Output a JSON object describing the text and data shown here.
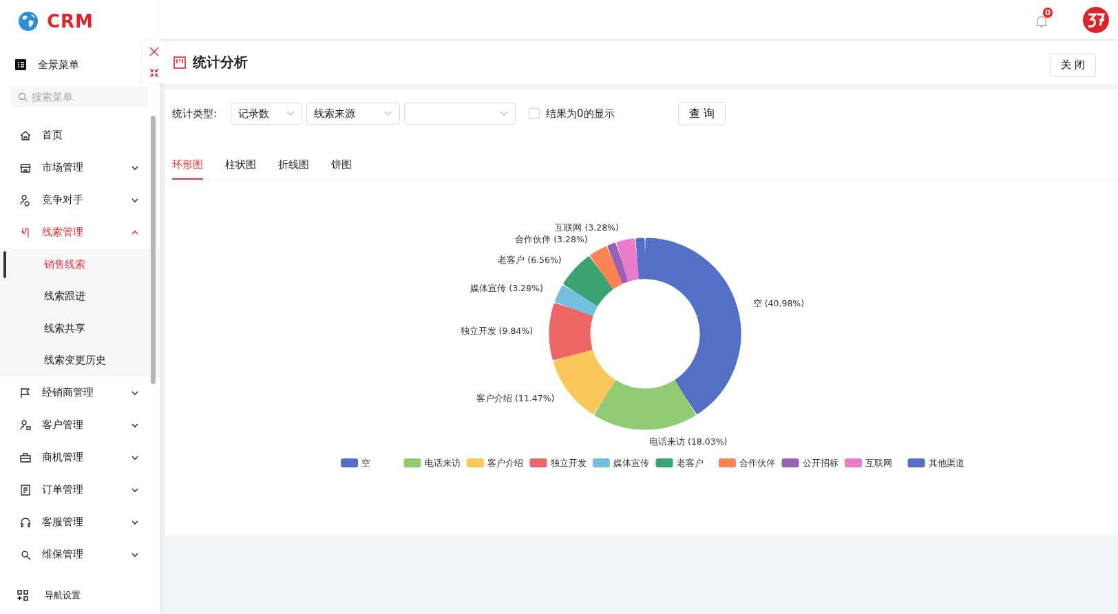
{
  "brand": {
    "logo_text": "CRM"
  },
  "topbar": {
    "notification_count": "0"
  },
  "sidebar": {
    "panorama_menu": "全景菜单",
    "search": {
      "placeholder": "搜索菜单"
    },
    "items": [
      {
        "label": "首页",
        "kind": "link",
        "selected": false
      },
      {
        "label": "市场管理",
        "kind": "group",
        "expanded": false,
        "selected": false
      },
      {
        "label": "竞争对手",
        "kind": "group",
        "expanded": false,
        "selected": false
      },
      {
        "label": "线索管理",
        "kind": "group",
        "expanded": true,
        "selected": true,
        "children": [
          {
            "label": "销售线索",
            "selected": true
          },
          {
            "label": "线索跟进",
            "selected": false
          },
          {
            "label": "线索共享",
            "selected": false
          },
          {
            "label": "线索变更历史",
            "selected": false
          }
        ]
      },
      {
        "label": "经销商管理",
        "kind": "group",
        "expanded": false,
        "selected": false
      },
      {
        "label": "客户管理",
        "kind": "group",
        "expanded": false,
        "selected": false
      },
      {
        "label": "商机管理",
        "kind": "group",
        "expanded": false,
        "selected": false
      },
      {
        "label": "订单管理",
        "kind": "group",
        "expanded": false,
        "selected": false
      },
      {
        "label": "客服管理",
        "kind": "group",
        "expanded": false,
        "selected": false
      },
      {
        "label": "维保管理",
        "kind": "group",
        "expanded": false,
        "selected": false
      }
    ],
    "footer": "导航设置"
  },
  "page": {
    "title": "统计分析",
    "close_button": "关 闭"
  },
  "filters": {
    "label": "统计类型:",
    "selects": [
      {
        "kind": "filled",
        "value": "记录数"
      },
      {
        "kind": "filled",
        "value": "线索来源"
      },
      {
        "kind": "empty"
      }
    ],
    "checkbox": {
      "label": "结果为0的显示",
      "checked": false
    },
    "query_button": "查 询"
  },
  "tabs": [
    {
      "label": "环形图",
      "selected": true
    },
    {
      "label": "柱状图",
      "selected": false
    },
    {
      "label": "折线图",
      "selected": false
    },
    {
      "label": "饼图",
      "selected": false
    }
  ],
  "chart_data": {
    "type": "donut",
    "categories": [
      "空",
      "电话来访",
      "客户介绍",
      "独立开发",
      "媒体宣传",
      "老客户",
      "合作伙伴",
      "公开招标",
      "互联网",
      "其他渠道"
    ],
    "legend": true,
    "series": [
      {
        "values": [
          40.98,
          18.03,
          11.47,
          9.84,
          3.28,
          6.56,
          3.28,
          1.64,
          3.28,
          1.64
        ]
      }
    ],
    "colors": [
      "#5470c6",
      "#91cc75",
      "#fac858",
      "#ee6666",
      "#73c0de",
      "#3ba272",
      "#fc8452",
      "#9a60b4",
      "#ea7ccc",
      "#5470c6"
    ],
    "value_labels": [
      "空 (40.98%)",
      "电话来访 (18.03%)",
      "客户介绍 (11.47%)",
      "独立开发 (9.84%)",
      "媒体宣传 (3.28%)",
      "老客户 (6.56%)",
      "合作伙伴 (3.28%)",
      null,
      "互联网 (3.28%)",
      null
    ]
  }
}
